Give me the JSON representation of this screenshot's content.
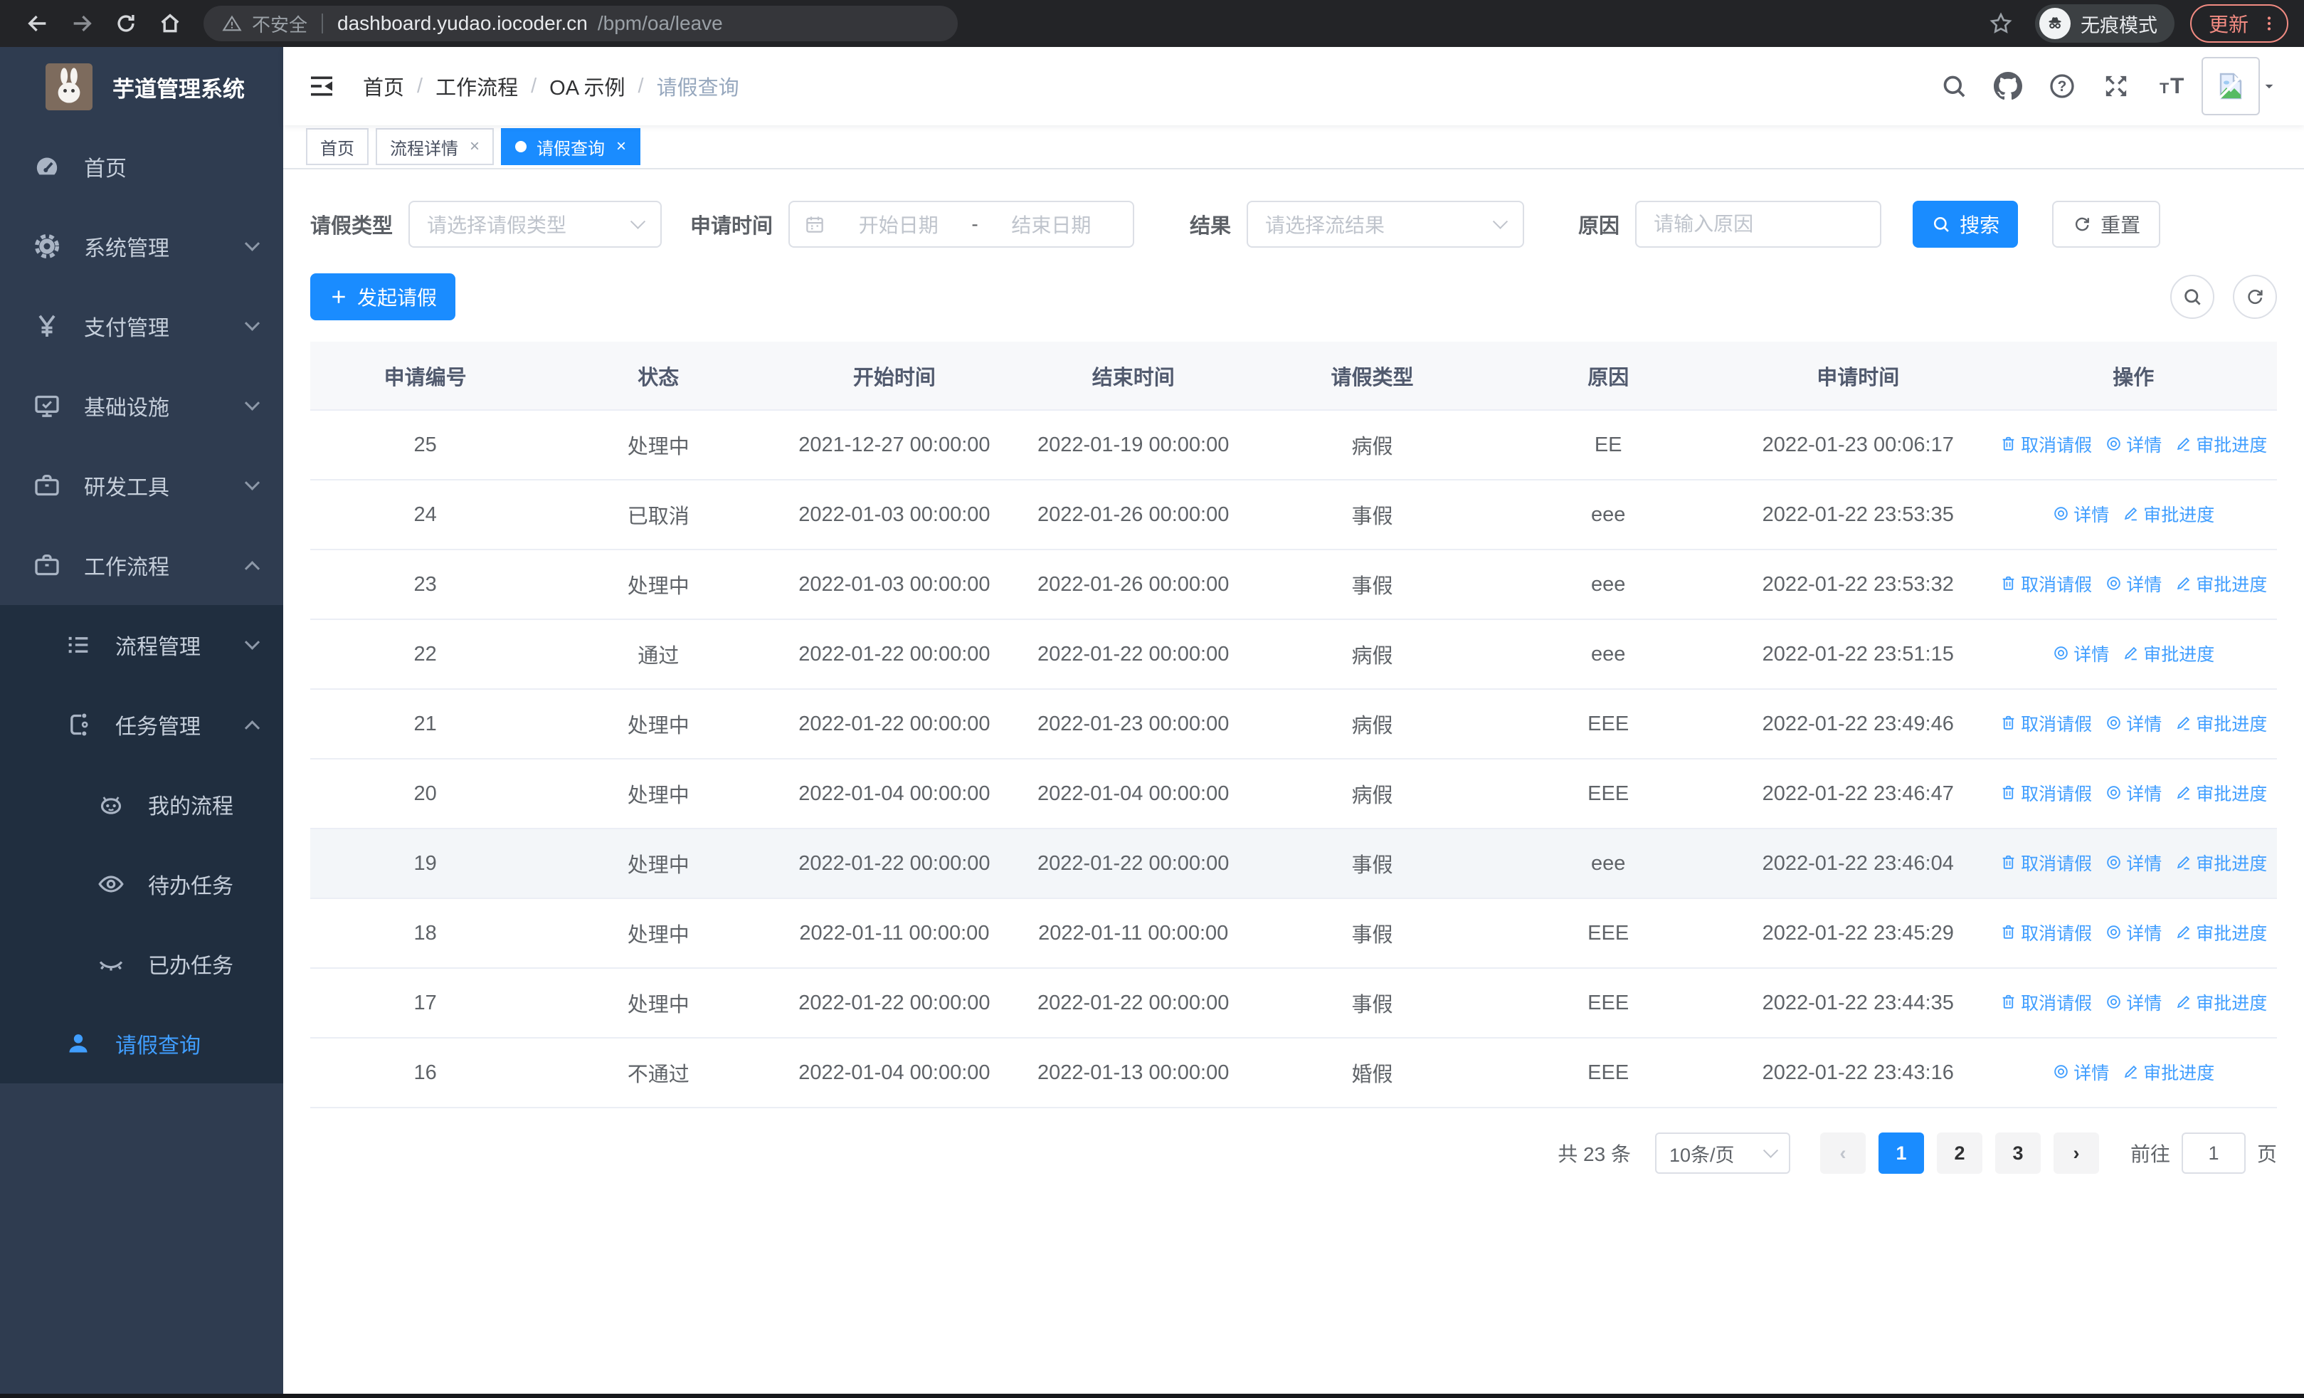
{
  "browser": {
    "security_label": "不安全",
    "url_host": "dashboard.yudao.iocoder.cn",
    "url_path": "/bpm/oa/leave",
    "incognito_label": "无痕模式",
    "update_label": "更新"
  },
  "sidebar": {
    "title": "芋道管理系统",
    "items": [
      {
        "label": "首页",
        "icon": "dashboard-icon"
      },
      {
        "label": "系统管理",
        "icon": "gear-icon",
        "chevron": "down"
      },
      {
        "label": "支付管理",
        "icon": "yen-icon",
        "chevron": "down"
      },
      {
        "label": "基础设施",
        "icon": "monitor-icon",
        "chevron": "down"
      },
      {
        "label": "研发工具",
        "icon": "toolbox-icon",
        "chevron": "down"
      },
      {
        "label": "工作流程",
        "icon": "briefcase-icon",
        "chevron": "up",
        "expanded": true,
        "children": [
          {
            "label": "流程管理",
            "icon": "list-icon",
            "chevron": "down",
            "indent": 2
          },
          {
            "label": "任务管理",
            "icon": "flow-icon",
            "chevron": "up",
            "indent": 2
          },
          {
            "label": "我的流程",
            "icon": "robot-icon",
            "indent": 3
          },
          {
            "label": "待办任务",
            "icon": "eye-icon",
            "indent": 3
          },
          {
            "label": "已办任务",
            "icon": "eye-closed-icon",
            "indent": 3
          },
          {
            "label": "请假查询",
            "icon": "user-icon",
            "indent": 2,
            "active": true
          }
        ]
      }
    ]
  },
  "header": {
    "breadcrumb": [
      "首页",
      "工作流程",
      "OA 示例",
      "请假查询"
    ],
    "icons": [
      "search-icon",
      "github-icon",
      "help-icon",
      "fullscreen-icon",
      "font-size-icon"
    ]
  },
  "tabs": [
    {
      "label": "首页",
      "closable": false,
      "active": false
    },
    {
      "label": "流程详情",
      "closable": true,
      "active": false
    },
    {
      "label": "请假查询",
      "closable": true,
      "active": true
    }
  ],
  "filters": {
    "leave_type_label": "请假类型",
    "leave_type_placeholder": "请选择请假类型",
    "apply_time_label": "申请时间",
    "date_start_placeholder": "开始日期",
    "date_separator": "-",
    "date_end_placeholder": "结束日期",
    "result_label": "结果",
    "result_placeholder": "请选择流结果",
    "reason_label": "原因",
    "reason_placeholder": "请输入原因",
    "search_label": "搜索",
    "reset_label": "重置"
  },
  "toolbar": {
    "create_label": "发起请假",
    "icons": [
      "search-icon",
      "refresh-icon"
    ]
  },
  "table": {
    "columns": [
      "申请编号",
      "状态",
      "开始时间",
      "结束时间",
      "请假类型",
      "原因",
      "申请时间",
      "操作"
    ],
    "action_labels": {
      "cancel": "取消请假",
      "detail": "详情",
      "progress": "审批进度"
    },
    "rows": [
      {
        "id": "25",
        "status": "处理中",
        "start": "2021-12-27 00:00:00",
        "end": "2022-01-19 00:00:00",
        "type": "病假",
        "reason": "EE",
        "apply_time": "2022-01-23 00:06:17",
        "actions": [
          "cancel",
          "detail",
          "progress"
        ],
        "highlighted": false
      },
      {
        "id": "24",
        "status": "已取消",
        "start": "2022-01-03 00:00:00",
        "end": "2022-01-26 00:00:00",
        "type": "事假",
        "reason": "eee",
        "apply_time": "2022-01-22 23:53:35",
        "actions": [
          "detail",
          "progress"
        ],
        "highlighted": false
      },
      {
        "id": "23",
        "status": "处理中",
        "start": "2022-01-03 00:00:00",
        "end": "2022-01-26 00:00:00",
        "type": "事假",
        "reason": "eee",
        "apply_time": "2022-01-22 23:53:32",
        "actions": [
          "cancel",
          "detail",
          "progress"
        ],
        "highlighted": false
      },
      {
        "id": "22",
        "status": "通过",
        "start": "2022-01-22 00:00:00",
        "end": "2022-01-22 00:00:00",
        "type": "病假",
        "reason": "eee",
        "apply_time": "2022-01-22 23:51:15",
        "actions": [
          "detail",
          "progress"
        ],
        "highlighted": false
      },
      {
        "id": "21",
        "status": "处理中",
        "start": "2022-01-22 00:00:00",
        "end": "2022-01-23 00:00:00",
        "type": "病假",
        "reason": "EEE",
        "apply_time": "2022-01-22 23:49:46",
        "actions": [
          "cancel",
          "detail",
          "progress"
        ],
        "highlighted": false
      },
      {
        "id": "20",
        "status": "处理中",
        "start": "2022-01-04 00:00:00",
        "end": "2022-01-04 00:00:00",
        "type": "病假",
        "reason": "EEE",
        "apply_time": "2022-01-22 23:46:47",
        "actions": [
          "cancel",
          "detail",
          "progress"
        ],
        "highlighted": false
      },
      {
        "id": "19",
        "status": "处理中",
        "start": "2022-01-22 00:00:00",
        "end": "2022-01-22 00:00:00",
        "type": "事假",
        "reason": "eee",
        "apply_time": "2022-01-22 23:46:04",
        "actions": [
          "cancel",
          "detail",
          "progress"
        ],
        "highlighted": true
      },
      {
        "id": "18",
        "status": "处理中",
        "start": "2022-01-11 00:00:00",
        "end": "2022-01-11 00:00:00",
        "type": "事假",
        "reason": "EEE",
        "apply_time": "2022-01-22 23:45:29",
        "actions": [
          "cancel",
          "detail",
          "progress"
        ],
        "highlighted": false
      },
      {
        "id": "17",
        "status": "处理中",
        "start": "2022-01-22 00:00:00",
        "end": "2022-01-22 00:00:00",
        "type": "事假",
        "reason": "EEE",
        "apply_time": "2022-01-22 23:44:35",
        "actions": [
          "cancel",
          "detail",
          "progress"
        ],
        "highlighted": false
      },
      {
        "id": "16",
        "status": "不通过",
        "start": "2022-01-04 00:00:00",
        "end": "2022-01-13 00:00:00",
        "type": "婚假",
        "reason": "EEE",
        "apply_time": "2022-01-22 23:43:16",
        "actions": [
          "detail",
          "progress"
        ],
        "highlighted": false
      }
    ]
  },
  "pagination": {
    "total": "共 23 条",
    "page_size": "10条/页",
    "pages": [
      "1",
      "2",
      "3"
    ],
    "active_page": "1",
    "goto_label": "前往",
    "goto_value": "1",
    "page_unit": "页"
  },
  "colors": {
    "primary": "#1a8cff",
    "link": "#409eff",
    "sidebar_bg": "#2f3c50",
    "submenu_bg": "#202e3f",
    "update_accent": "#f28b82"
  }
}
